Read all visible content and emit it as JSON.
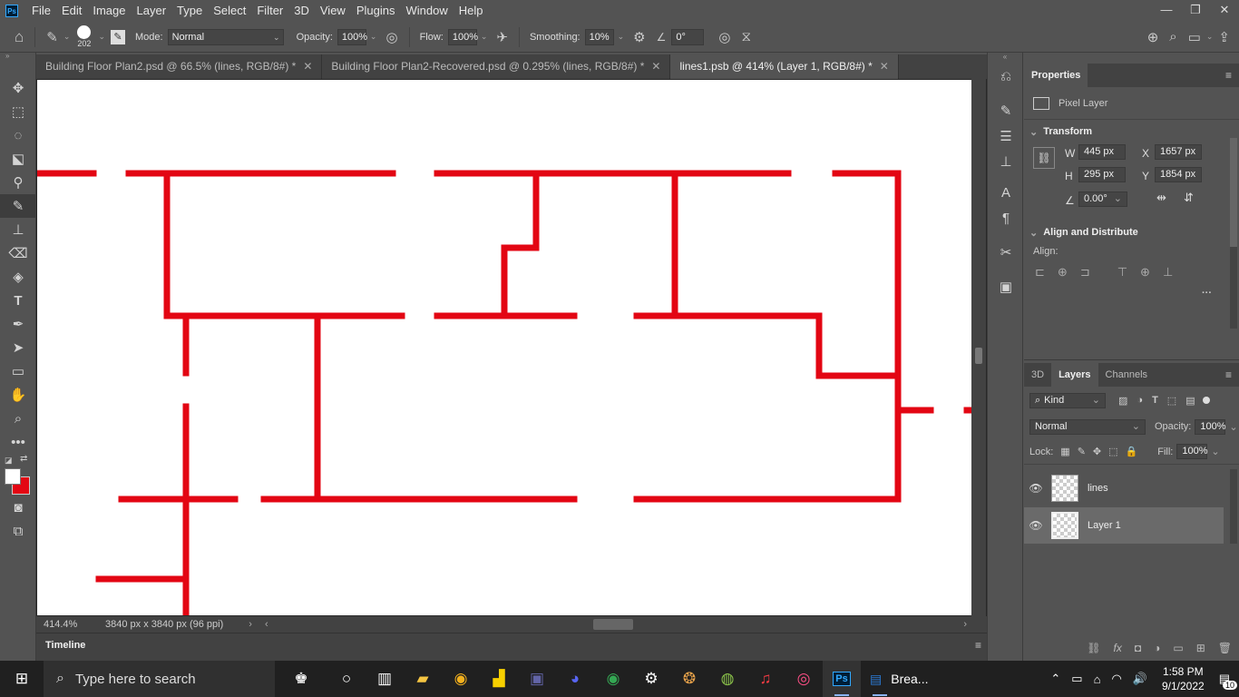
{
  "app": {
    "logo": "Ps"
  },
  "menu": [
    "File",
    "Edit",
    "Image",
    "Layer",
    "Type",
    "Select",
    "Filter",
    "3D",
    "View",
    "Plugins",
    "Window",
    "Help"
  ],
  "window_controls": [
    "—",
    "❐",
    "✕"
  ],
  "options": {
    "brush_size": "202",
    "mode_label": "Mode:",
    "mode_value": "Normal",
    "opacity_label": "Opacity:",
    "opacity_value": "100%",
    "flow_label": "Flow:",
    "flow_value": "100%",
    "smoothing_label": "Smoothing:",
    "smoothing_value": "10%",
    "angle_value": "0°"
  },
  "tabs": [
    {
      "label": "Building Floor Plan2.psd @ 66.5% (lines, RGB/8#) *"
    },
    {
      "label": "Building Floor Plan2-Recovered.psd @ 0.295% (lines, RGB/8#) *"
    },
    {
      "label": "lines1.psb @ 414% (Layer 1, RGB/8#) *"
    }
  ],
  "status": {
    "zoom": "414.4%",
    "doc_size": "3840 px x 3840 px (96 ppi)"
  },
  "timeline": {
    "label": "Timeline"
  },
  "properties": {
    "tab": "Properties",
    "layer_type": "Pixel Layer",
    "transform_label": "Transform",
    "w_label": "W",
    "w_value": "445 px",
    "h_label": "H",
    "h_value": "295 px",
    "x_label": "X",
    "x_value": "1657 px",
    "y_label": "Y",
    "y_value": "1854 px",
    "angle_value": "0.00°",
    "align_label": "Align and Distribute",
    "align_sub": "Align:",
    "more": "···"
  },
  "layers_panel": {
    "tabs": [
      "3D",
      "Layers",
      "Channels"
    ],
    "kind_label": "Kind",
    "blend_mode": "Normal",
    "opacity_label": "Opacity:",
    "opacity_value": "100%",
    "lock_label": "Lock:",
    "fill_label": "Fill:",
    "fill_value": "100%",
    "layers": [
      {
        "name": "lines"
      },
      {
        "name": "Layer 1"
      }
    ]
  },
  "taskbar": {
    "search_placeholder": "Type here to search",
    "active_window_label": "Brea...",
    "time": "1:58 PM",
    "date": "9/1/2022",
    "notification_count": "10"
  },
  "colors": {
    "accent_red": "#e30613",
    "canvas": "#ffffff",
    "ui_bg": "#535353"
  }
}
